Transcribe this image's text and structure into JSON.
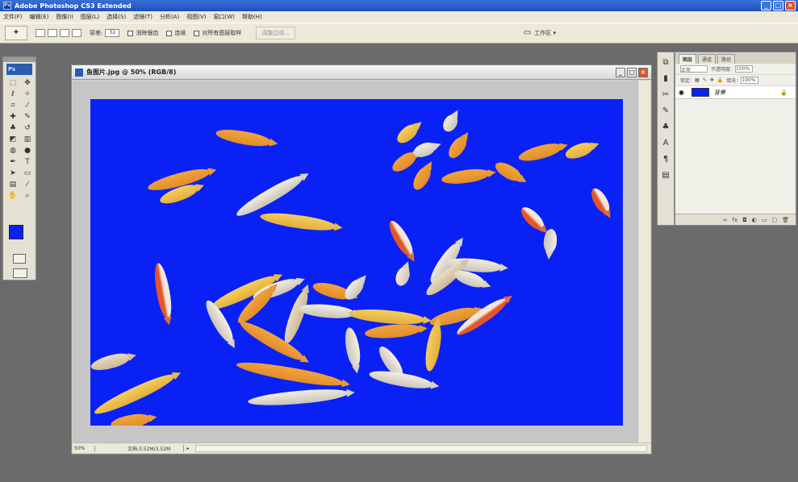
{
  "window": {
    "title": "Adobe Photoshop CS3 Extended",
    "app_icon": "Ps"
  },
  "menu": [
    "文件(F)",
    "编辑(E)",
    "图像(I)",
    "图层(L)",
    "选择(S)",
    "滤镜(T)",
    "分析(A)",
    "视图(V)",
    "窗口(W)",
    "帮助(H)"
  ],
  "options": {
    "tool_icon": "magic-wand-icon",
    "tolerance_label": "容差:",
    "tolerance_value": "32",
    "antialias_label": "消除锯齿",
    "contiguous_label": "连续",
    "all_layers_label": "对所有图层取样",
    "refine_edge_label": "调整边缘...",
    "workspace_label": "工作区 ▾"
  },
  "toolbox": {
    "logo": "Ps",
    "foreground_color": "#0a21f5",
    "background_color": "#ffffff"
  },
  "document": {
    "title": "鱼图片.jpg @ 50% (RGB/8)",
    "zoom": "50%",
    "info": "文档:3.52M/3.52M",
    "canvas_color": "#0a21f5"
  },
  "layers_panel": {
    "tabs": [
      "图层",
      "通道",
      "路径"
    ],
    "blend_mode": "正常",
    "opacity_label": "不透明度:",
    "opacity_value": "100%",
    "lock_label": "锁定:",
    "fill_label": "填充:",
    "fill_value": "100%",
    "layer_name": "背景"
  }
}
